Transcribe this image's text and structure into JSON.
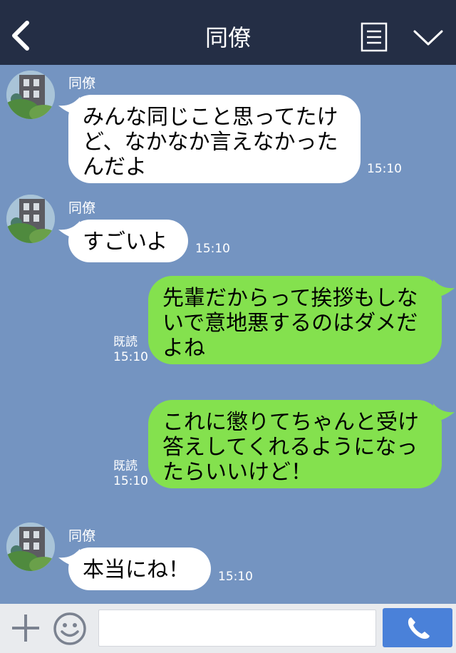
{
  "header": {
    "title": "同僚",
    "back_icon": "chevron-left-icon",
    "notes_icon": "notes-icon",
    "menu_icon": "chevron-down-icon"
  },
  "messages": [
    {
      "direction": "in",
      "sender": "同僚",
      "lines": [
        "みんな同じこと思ってたけ",
        "ど、なかなか言えなかった",
        "んだよ"
      ],
      "time": "15:10"
    },
    {
      "direction": "in",
      "sender": "同僚",
      "lines": [
        "すごいよ"
      ],
      "time": "15:10"
    },
    {
      "direction": "out",
      "read": "既読",
      "lines": [
        "先輩だからって挨拶もしな",
        "いで意地悪するのはダメだ",
        "よね"
      ],
      "time": "15:10"
    },
    {
      "direction": "out",
      "read": "既読",
      "lines": [
        "これに懲りてちゃんと受け",
        "答えしてくれるようになっ",
        "たらいいけど！"
      ],
      "time": "15:10"
    },
    {
      "direction": "in",
      "sender": "同僚",
      "lines": [
        "本当にね！"
      ],
      "time": "15:10"
    }
  ],
  "input_bar": {
    "plus_icon": "plus-icon",
    "emoji_icon": "smiley-icon",
    "input_value": "",
    "call_icon": "phone-icon"
  },
  "colors": {
    "header_bg": "#242e45",
    "chat_bg": "#7494c1",
    "incoming_bubble": "#ffffff",
    "outgoing_bubble": "#84e14e",
    "call_button": "#4a81d9"
  }
}
